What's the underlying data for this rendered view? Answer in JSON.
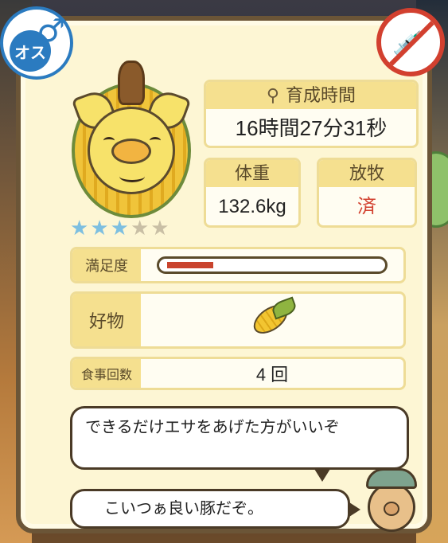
{
  "status": {
    "gender_label": "オス",
    "gender_symbol": "♂",
    "vaccine_icon": "syringe-crossed-icon"
  },
  "stats": {
    "time_header": "育成時間",
    "time_value": "16時間27分31秒",
    "weight_header": "体重",
    "weight_value": "132.6kg",
    "graze_header": "放牧",
    "graze_value": "済"
  },
  "rating": {
    "stars_filled": 3,
    "stars_total": 5,
    "filled_color": "#7dbfe0",
    "empty_color": "#c9bfa5"
  },
  "satisfaction": {
    "label": "満足度",
    "level": 0.22,
    "bar_color": "#c9442e"
  },
  "favorite": {
    "label": "好物",
    "icon": "corn-icon"
  },
  "meals": {
    "label": "食事回数",
    "value": "4 回"
  },
  "dialogue": {
    "line1": "できるだけエサをあげた方がいいぞ",
    "line2": "こいつぁ良い豚だぞ。"
  }
}
